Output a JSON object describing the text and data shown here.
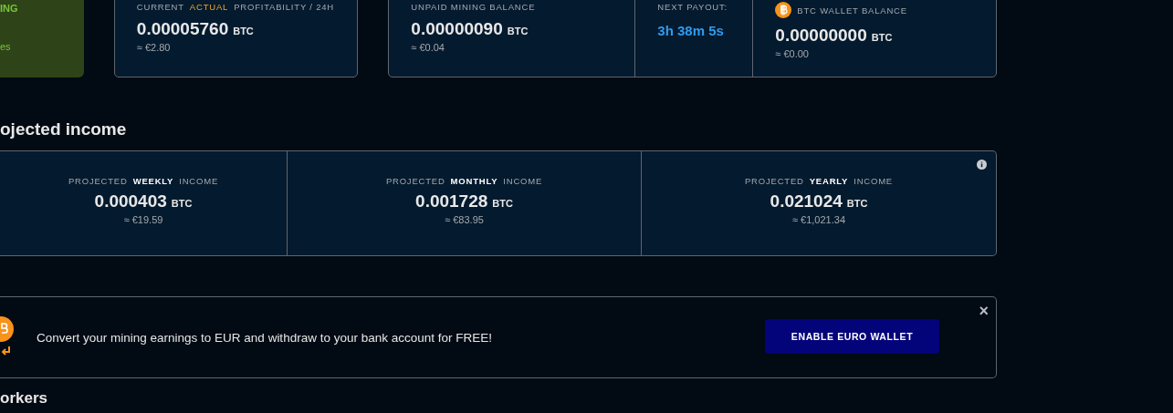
{
  "status_card": {
    "lines": [
      "ING",
      "es"
    ]
  },
  "profitability": {
    "label": "CURRENT **ACTUAL** PROFITABILITY / 24H",
    "value": "0.00005760",
    "unit": "BTC",
    "fiat": "≈ €2.80"
  },
  "unpaid_balance": {
    "label": "UNPAID MINING BALANCE",
    "value": "0.00000090",
    "unit": "BTC",
    "fiat": "≈ €0.04"
  },
  "next_payout": {
    "label": "NEXT PAYOUT:",
    "value": "3h 38m 5s"
  },
  "wallet_balance": {
    "label": "BTC WALLET BALANCE",
    "value": "0.00000000",
    "unit": "BTC",
    "fiat": "≈ €0.00"
  },
  "projected": {
    "heading": "ojected income",
    "items": [
      {
        "label": "PROJECTED **WEEKLY** INCOME",
        "value": "0.000403",
        "unit": "BTC",
        "fiat": "≈ €19.59"
      },
      {
        "label": "PROJECTED **MONTHLY** INCOME",
        "value": "0.001728",
        "unit": "BTC",
        "fiat": "≈ €83.95"
      },
      {
        "label": "PROJECTED **YEARLY** INCOME",
        "value": "0.021024",
        "unit": "BTC",
        "fiat": "≈ €1,021.34"
      }
    ]
  },
  "banner": {
    "text": "Convert your mining earnings to EUR and withdraw to your bank account for FREE!",
    "button": "ENABLE EURO WALLET",
    "close": "×"
  },
  "next_heading": "orkers"
}
